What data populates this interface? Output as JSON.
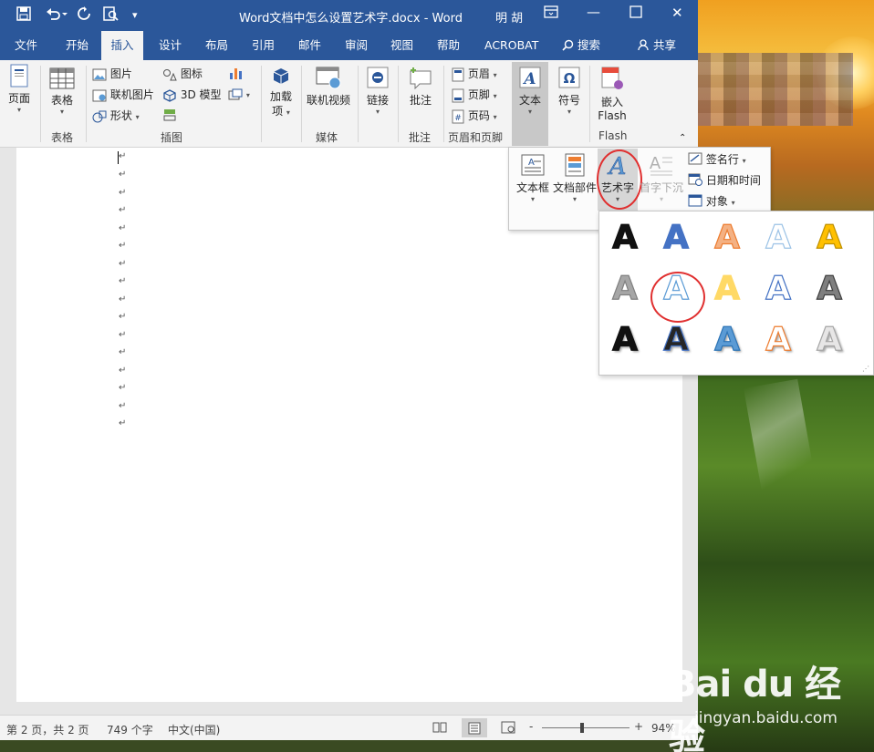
{
  "window": {
    "title": "Word文档中怎么设置艺术字.docx  -  Word",
    "user": "明 胡"
  },
  "tabs": [
    "文件",
    "开始",
    "插入",
    "设计",
    "布局",
    "引用",
    "邮件",
    "审阅",
    "视图",
    "帮助",
    "ACROBAT"
  ],
  "active_tab": "插入",
  "search_label": "搜索",
  "share_label": "共享",
  "ribbon": {
    "page_label": "页面",
    "table_label": "表格",
    "table_group": "表格",
    "illustrations": {
      "picture": "图片",
      "online_picture": "联机图片",
      "shapes": "形状",
      "icons": "图标",
      "models_3d": "3D 模型",
      "group": "插图"
    },
    "addins": "加载\n项",
    "addins_line1": "加载",
    "addins_line2": "项",
    "online_video": "联机视频",
    "media_group": "媒体",
    "link": "链接",
    "comment": "批注",
    "comment_group": "批注",
    "header": "页眉",
    "footer": "页脚",
    "page_number": "页码",
    "header_footer_group": "页眉和页脚",
    "text": "文本",
    "symbol": "符号",
    "embed_flash_line1": "嵌入",
    "embed_flash_line2": "Flash",
    "flash_group": "Flash"
  },
  "text_panel": {
    "text_box": "文本框",
    "doc_parts": "文档部件",
    "wordart": "艺术字",
    "drop_cap": "首字下沉",
    "signature_line": "签名行",
    "date_time": "日期和时间",
    "object": "对象"
  },
  "wordart_gallery": {
    "glyph": "A",
    "highlighted_index": 6,
    "styles": [
      {
        "fill": "#111111",
        "stroke": "#111111"
      },
      {
        "fill": "#4472c4",
        "stroke": "#4472c4"
      },
      {
        "fill": "#f4b183",
        "stroke": "#ed7d31"
      },
      {
        "fill": "#ffffff",
        "stroke": "#9dc3e6"
      },
      {
        "fill": "#ffc000",
        "stroke": "#bf9000"
      },
      {
        "fill": "#a6a6a6",
        "stroke": "#808080"
      },
      {
        "fill": "#ffffff",
        "stroke": "#5b9bd5"
      },
      {
        "fill": "#ffd966",
        "stroke": "#ffd966"
      },
      {
        "fill": "#ffffff",
        "stroke": "#4472c4"
      },
      {
        "fill": "#7f7f7f",
        "stroke": "#404040"
      },
      {
        "fill": "#111111",
        "stroke": "#111111"
      },
      {
        "fill": "#262626",
        "stroke": "#4472c4"
      },
      {
        "fill": "#5b9bd5",
        "stroke": "#2e75b6"
      },
      {
        "fill": "#ffffff",
        "stroke": "#ed7d31"
      },
      {
        "fill": "#e7e6e6",
        "stroke": "#a6a6a6"
      }
    ]
  },
  "document": {
    "paragraph_mark": "↵"
  },
  "status": {
    "page": "第 2 页，共 2 页",
    "words": "749 个字",
    "language": "中文(中国)",
    "zoom": "94%",
    "zoom_minus": "-",
    "zoom_plus": "+"
  },
  "watermark": {
    "logo": "Bai du 经验",
    "url": "jingyan.baidu.com"
  }
}
